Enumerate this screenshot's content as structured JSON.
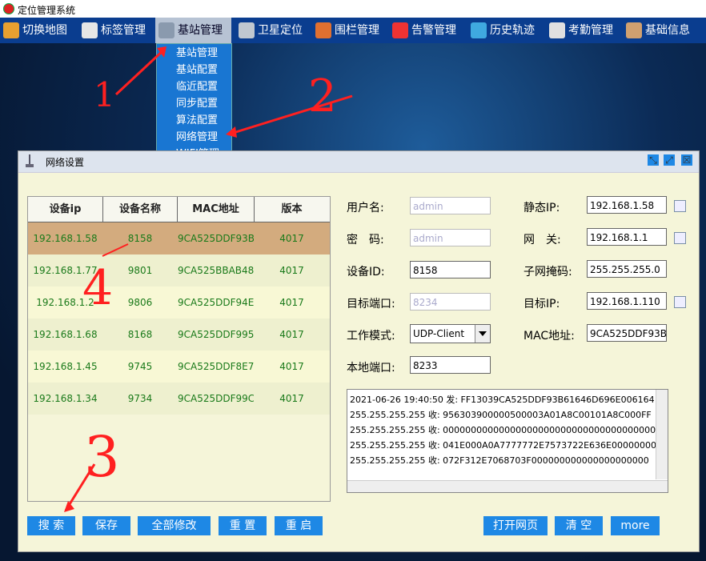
{
  "app": {
    "title": "定位管理系统"
  },
  "menu": [
    {
      "label": "切换地图",
      "icon": "map-icon"
    },
    {
      "label": "标签管理",
      "icon": "id-card-icon"
    },
    {
      "label": "基站管理",
      "icon": "antenna-icon"
    },
    {
      "label": "卫星定位",
      "icon": "satellite-icon"
    },
    {
      "label": "围栏管理",
      "icon": "fence-icon"
    },
    {
      "label": "告警管理",
      "icon": "warning-icon"
    },
    {
      "label": "历史轨迹",
      "icon": "route-icon"
    },
    {
      "label": "考勤管理",
      "icon": "clipboard-icon"
    },
    {
      "label": "基础信息",
      "icon": "users-icon"
    }
  ],
  "dropdown": [
    "基站管理",
    "基站配置",
    "临近配置",
    "同步配置",
    "算法配置",
    "网络管理",
    "WIFI管理"
  ],
  "dialog": {
    "title": "网络设置"
  },
  "table": {
    "headers": [
      "设备ip",
      "设备名称",
      "MAC地址",
      "版本"
    ],
    "rows": [
      [
        "192.168.1.58",
        "8158",
        "9CA525DDF93B",
        "4017"
      ],
      [
        "192.168.1.77",
        "9801",
        "9CA525BBAB48",
        "4017"
      ],
      [
        "192.168.1.2",
        "9806",
        "9CA525DDF94E",
        "4017"
      ],
      [
        "192.168.1.68",
        "8168",
        "9CA525DDF995",
        "4017"
      ],
      [
        "192.168.1.45",
        "9745",
        "9CA525DDF8E7",
        "4017"
      ],
      [
        "192.168.1.34",
        "9734",
        "9CA525DDF99C",
        "4017"
      ]
    ]
  },
  "form": {
    "username_label": "用户名:",
    "username": "admin",
    "password_label": "密　码:",
    "password": "admin",
    "device_id_label": "设备ID:",
    "device_id": "8158",
    "target_port_label": "目标端口:",
    "target_port": "8234",
    "work_mode_label": "工作模式:",
    "work_mode": "UDP-Client",
    "local_port_label": "本地端口:",
    "local_port": "8233",
    "static_ip_label": "静态IP:",
    "static_ip": "192.168.1.58",
    "gateway_label": "网　关:",
    "gateway": "192.168.1.1",
    "subnet_label": "子网掩码:",
    "subnet": "255.255.255.0",
    "target_ip_label": "目标IP:",
    "target_ip": "192.168.1.110",
    "mac_label": "MAC地址:",
    "mac": "9CA525DDF93B"
  },
  "log": [
    "2021-06-26 19:40:50 发: FF13039CA525DDF93B61646D696E006164",
    "255.255.255.255 收: 956303900000500003A01A8C00101A8C000FF",
    "255.255.255.255 收: 00000000000000000000000000000000000000",
    "255.255.255.255 收: 041E000A0A7777772E7573722E636E00000000",
    "255.255.255.255 收: 072F312E7068703F000000000000000000000"
  ],
  "buttons": {
    "search": "搜 索",
    "save": "保存",
    "modify_all": "全部修改",
    "reset": "重 置",
    "restart": "重 启",
    "open_web": "打开网页",
    "clear": "清 空",
    "more": "more"
  },
  "annotations": {
    "n1": "1",
    "n2": "2",
    "n3": "3",
    "n4": "4"
  },
  "colors": {
    "menubar": "#0a3d8f",
    "dropdown": "#1976d2",
    "button": "#1e88e5",
    "selected_row": "#d3ab7e",
    "panel": "#f5f5d9",
    "annotation": "#ff2020"
  }
}
